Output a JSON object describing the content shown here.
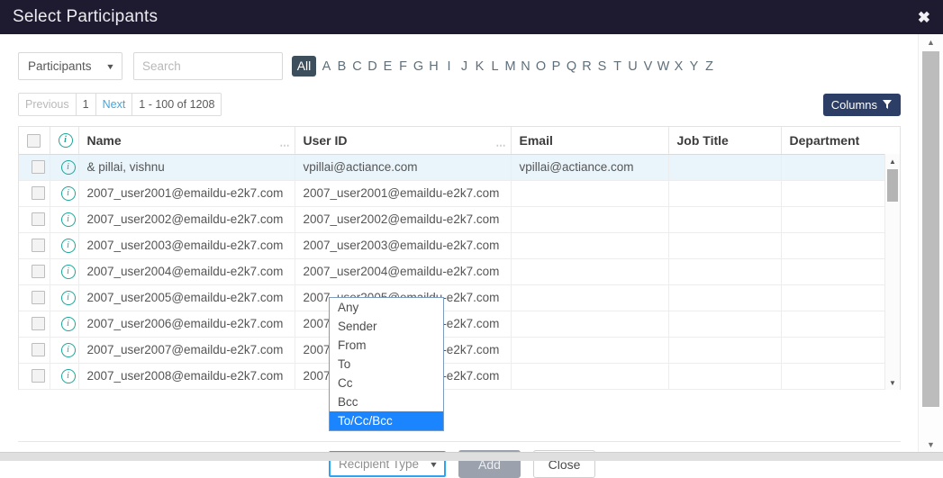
{
  "window": {
    "title": "Select Participants",
    "close_icon": "close-x-icon"
  },
  "filterbar": {
    "entity_select_value": "Participants",
    "entity_caret": "▼",
    "search_placeholder": "Search",
    "search_value": "",
    "alpha_all": "All",
    "alphabet": [
      "A",
      "B",
      "C",
      "D",
      "E",
      "F",
      "G",
      "H",
      "I",
      "J",
      "K",
      "L",
      "M",
      "N",
      "O",
      "P",
      "Q",
      "R",
      "S",
      "T",
      "U",
      "V",
      "W",
      "X",
      "Y",
      "Z"
    ],
    "active_letter": "All"
  },
  "pager": {
    "previous": "Previous",
    "page_number": "1",
    "next": "Next",
    "range_info": "1 - 100 of 1208",
    "columns_button": "Columns",
    "columns_icon": "filter-funnel-icon"
  },
  "table": {
    "headers": [
      "",
      "",
      "Name",
      "User ID",
      "Email",
      "Job Title",
      "Department"
    ],
    "rows": [
      {
        "selected": true,
        "name": "& pillai, vishnu",
        "user_id": "vpillai@actiance.com",
        "email": "vpillai@actiance.com",
        "job_title": "",
        "department": ""
      },
      {
        "selected": false,
        "name": "2007_user2001@emaildu-e2k7.com",
        "user_id": "2007_user2001@emaildu-e2k7.com",
        "email": "",
        "job_title": "",
        "department": ""
      },
      {
        "selected": false,
        "name": "2007_user2002@emaildu-e2k7.com",
        "user_id": "2007_user2002@emaildu-e2k7.com",
        "email": "",
        "job_title": "",
        "department": ""
      },
      {
        "selected": false,
        "name": "2007_user2003@emaildu-e2k7.com",
        "user_id": "2007_user2003@emaildu-e2k7.com",
        "email": "",
        "job_title": "",
        "department": ""
      },
      {
        "selected": false,
        "name": "2007_user2004@emaildu-e2k7.com",
        "user_id": "2007_user2004@emaildu-e2k7.com",
        "email": "",
        "job_title": "",
        "department": ""
      },
      {
        "selected": false,
        "name": "2007_user2005@emaildu-e2k7.com",
        "user_id": "2007_user2005@emaildu-e2k7.com",
        "email": "",
        "job_title": "",
        "department": ""
      },
      {
        "selected": false,
        "name": "2007_user2006@emaildu-e2k7.com",
        "user_id": "2007_user2006@emaildu-e2k7.com",
        "email": "",
        "job_title": "",
        "department": ""
      },
      {
        "selected": false,
        "name": "2007_user2007@emaildu-e2k7.com",
        "user_id": "2007_user2007@emaildu-e2k7.com",
        "email": "",
        "job_title": "",
        "department": ""
      },
      {
        "selected": false,
        "name": "2007_user2008@emaildu-e2k7.com",
        "user_id": "2007_user2008@emaildu-e2k7.com",
        "email": "",
        "job_title": "",
        "department": ""
      }
    ]
  },
  "footer": {
    "recipient_type_label": "Recipient Type",
    "recipient_type_caret": "▼",
    "add_label": "Add",
    "close_label": "Close"
  },
  "dropdown": {
    "open": true,
    "options": [
      "Any",
      "Sender",
      "From",
      "To",
      "Cc",
      "Bcc",
      "To/Cc/Bcc"
    ],
    "selected": "To/Cc/Bcc"
  },
  "colors": {
    "titlebar_bg": "#1e1b30",
    "accent_blue": "#1a85ff",
    "columns_btn_bg": "#2c3e66",
    "alpha_all_bg": "#3d4f5d",
    "info_icon": "#1aa79a",
    "row_selected_bg": "#eaf5fb",
    "focus_border": "#2ea3f2"
  }
}
